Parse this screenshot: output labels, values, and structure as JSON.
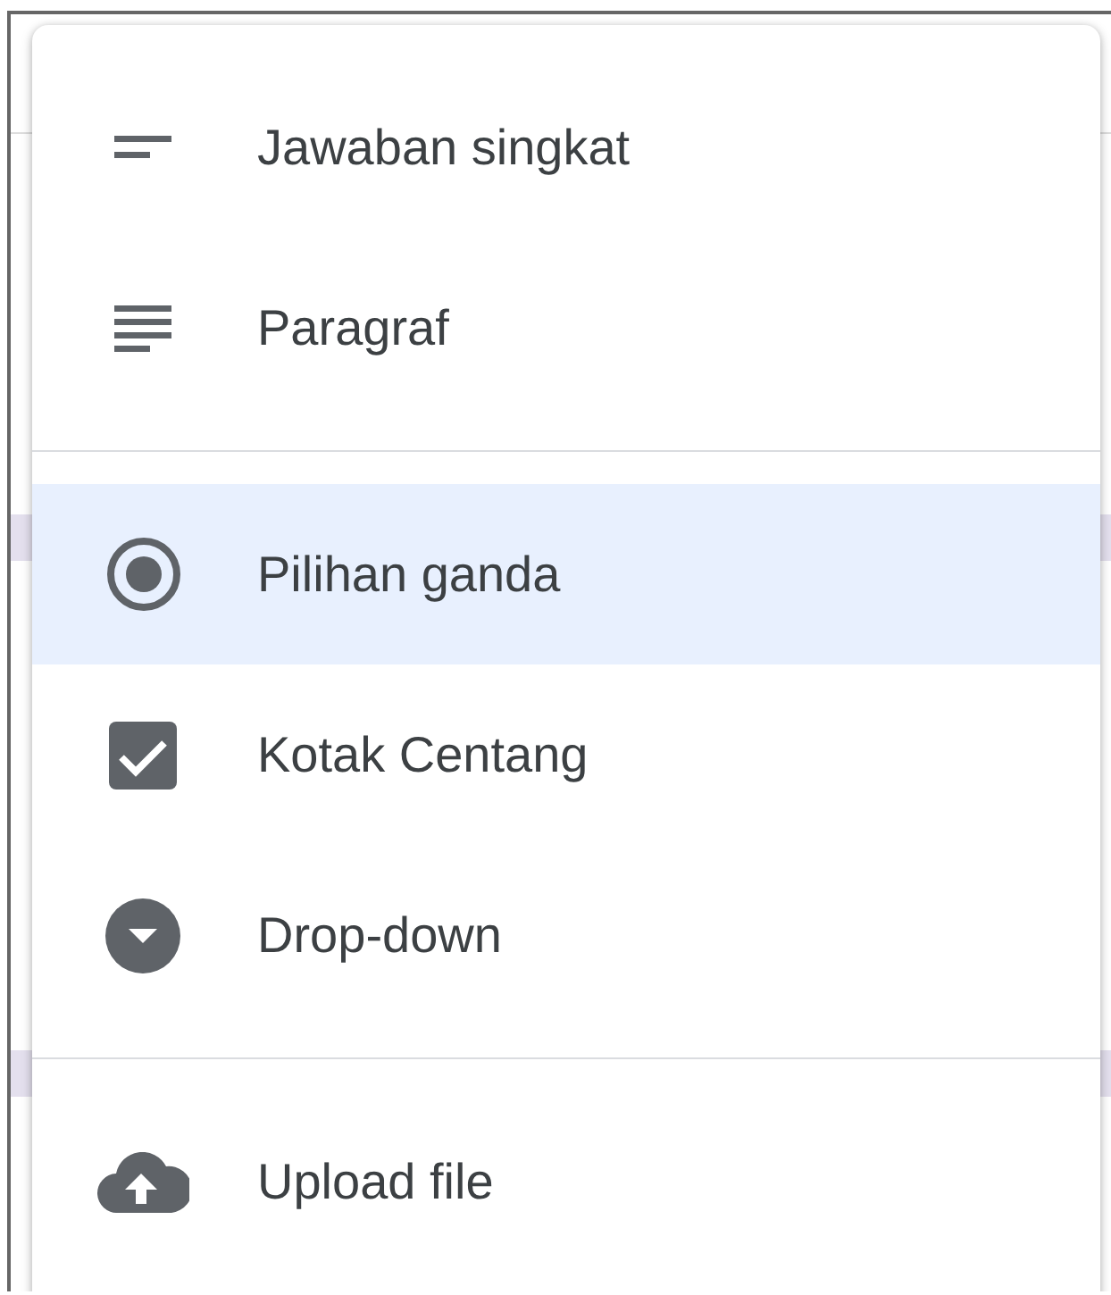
{
  "menu": {
    "sections": [
      {
        "items": [
          {
            "kind": "short-answer",
            "label": "Jawaban singkat",
            "selected": false
          },
          {
            "kind": "paragraph",
            "label": "Paragraf",
            "selected": false
          }
        ]
      },
      {
        "items": [
          {
            "kind": "radio",
            "label": "Pilihan ganda",
            "selected": true
          },
          {
            "kind": "checkbox",
            "label": "Kotak Centang",
            "selected": false
          },
          {
            "kind": "dropdown",
            "label": "Drop-down",
            "selected": false
          }
        ]
      },
      {
        "items": [
          {
            "kind": "upload",
            "label": "Upload file",
            "selected": false
          }
        ]
      }
    ]
  }
}
